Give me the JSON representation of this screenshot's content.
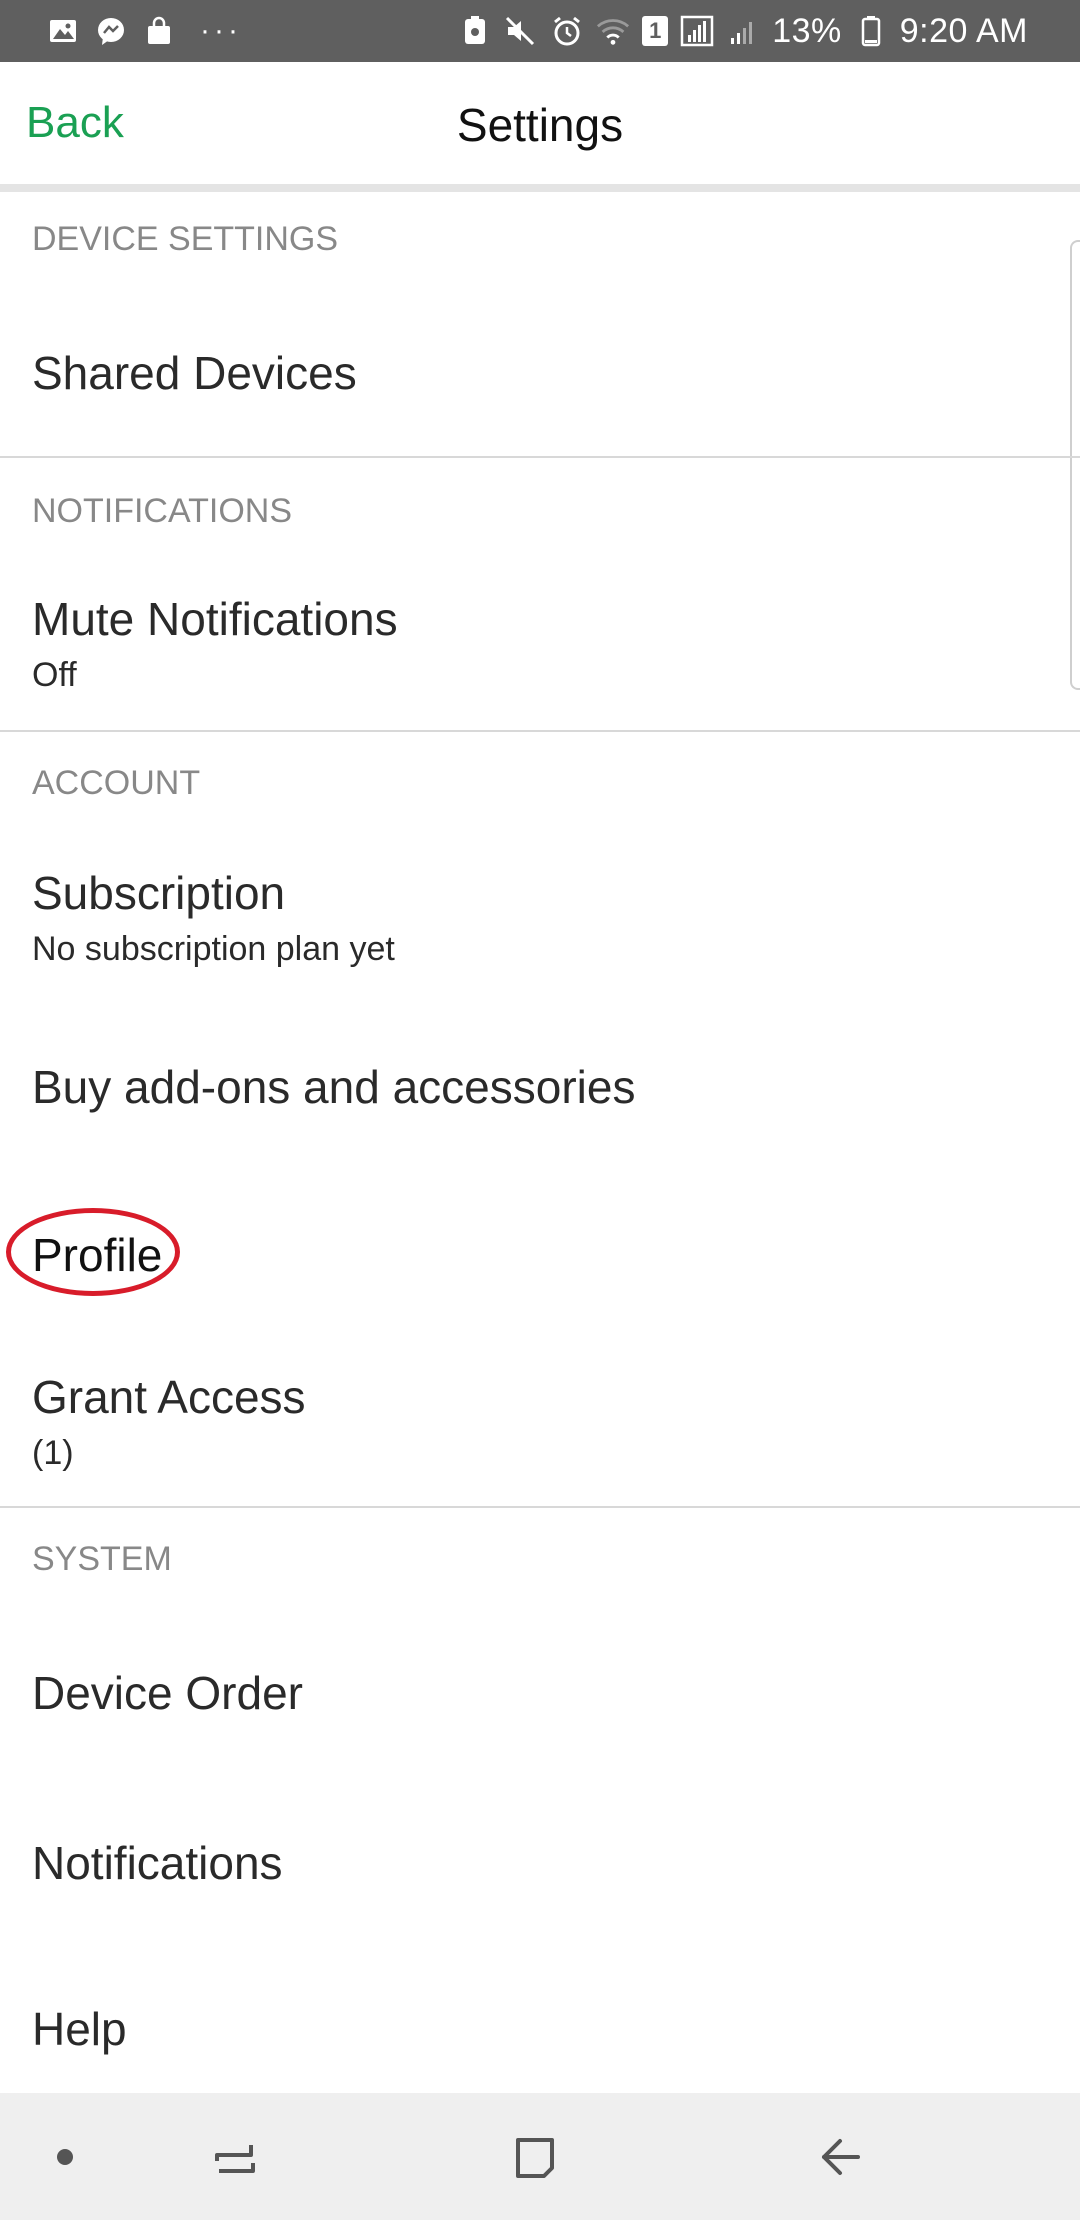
{
  "status_bar": {
    "battery": "13%",
    "time": "9:20 AM",
    "sim_label": "1",
    "more": "···"
  },
  "header": {
    "back_label": "Back",
    "title": "Settings",
    "back_color": "#1aa053"
  },
  "sections": {
    "device_settings": {
      "label": "DEVICE SETTINGS",
      "shared_devices": "Shared Devices"
    },
    "notifications": {
      "label": "NOTIFICATIONS",
      "mute_title": "Mute Notifications",
      "mute_value": "Off"
    },
    "account": {
      "label": "ACCOUNT",
      "subscription_title": "Subscription",
      "subscription_value": "No subscription plan yet",
      "buy_addons": "Buy add-ons and accessories",
      "profile": "Profile",
      "grant_access_title": "Grant Access",
      "grant_access_value": "(1)"
    },
    "system": {
      "label": "SYSTEM",
      "device_order": "Device Order",
      "notifications": "Notifications",
      "help": "Help"
    }
  },
  "annotation": {
    "highlight_color": "#d81c2a",
    "highlighted_item": "Profile"
  },
  "icons": [
    "image-icon",
    "messenger-icon",
    "shopping-bag-icon",
    "nfc-icon",
    "mute-icon",
    "alarm-icon",
    "wifi-icon",
    "signal-icon",
    "battery-icon",
    "recent-apps-icon",
    "home-icon",
    "back-arrow-icon"
  ]
}
